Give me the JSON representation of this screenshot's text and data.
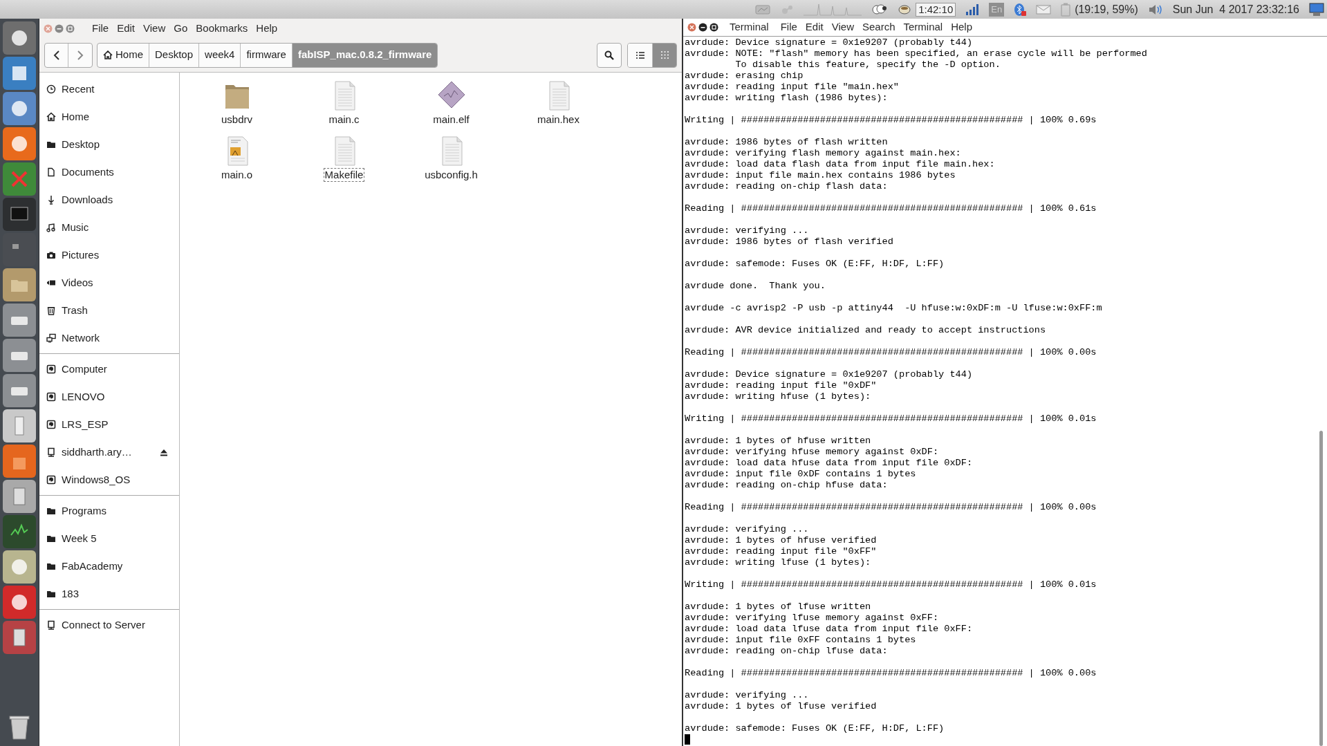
{
  "top_panel": {
    "timer": "1:42:10",
    "keyboard": "En",
    "battery": "(19:19, 59%)",
    "datetime": "Sun Jun  4 2017 23:32:16"
  },
  "file_manager": {
    "menu": [
      "File",
      "Edit",
      "View",
      "Go",
      "Bookmarks",
      "Help"
    ],
    "breadcrumb": [
      {
        "label": "Home",
        "kind": "home",
        "selected": false
      },
      {
        "label": "Desktop",
        "kind": "plain",
        "selected": false
      },
      {
        "label": "week4",
        "kind": "plain",
        "selected": false
      },
      {
        "label": "firmware",
        "kind": "plain",
        "selected": false
      },
      {
        "label": "fabISP_mac.0.8.2_firmware",
        "kind": "plain",
        "selected": true
      }
    ],
    "views": [
      {
        "kind": "list",
        "selected": false
      },
      {
        "kind": "grid",
        "selected": true
      }
    ],
    "sidebar": [
      [
        {
          "label": "Recent",
          "kind": "clock",
          "ejectable": false
        },
        {
          "label": "Home",
          "kind": "home",
          "ejectable": false
        },
        {
          "label": "Desktop",
          "kind": "folder",
          "ejectable": false
        },
        {
          "label": "Documents",
          "kind": "document",
          "ejectable": false
        },
        {
          "label": "Downloads",
          "kind": "download",
          "ejectable": false
        },
        {
          "label": "Music",
          "kind": "music",
          "ejectable": false
        },
        {
          "label": "Pictures",
          "kind": "camera",
          "ejectable": false
        },
        {
          "label": "Videos",
          "kind": "video",
          "ejectable": false
        },
        {
          "label": "Trash",
          "kind": "trash",
          "ejectable": false
        },
        {
          "label": "Network",
          "kind": "network",
          "ejectable": false
        }
      ],
      [
        {
          "label": "Computer",
          "kind": "drive",
          "ejectable": false
        },
        {
          "label": "LENOVO",
          "kind": "drive",
          "ejectable": false
        },
        {
          "label": "LRS_ESP",
          "kind": "drive",
          "ejectable": false
        },
        {
          "label": "siddharth.ary…",
          "kind": "server",
          "ejectable": true
        },
        {
          "label": "Windows8_OS",
          "kind": "drive",
          "ejectable": false
        }
      ],
      [
        {
          "label": "Programs",
          "kind": "folder",
          "ejectable": false
        },
        {
          "label": "Week 5",
          "kind": "folder",
          "ejectable": false
        },
        {
          "label": "FabAcademy",
          "kind": "folder",
          "ejectable": false
        },
        {
          "label": "183",
          "kind": "folder",
          "ejectable": false
        }
      ],
      [
        {
          "label": "Connect to Server",
          "kind": "server",
          "ejectable": false
        }
      ]
    ],
    "files": [
      {
        "name": "usbdrv",
        "kind": "folder",
        "focused": false
      },
      {
        "name": "main.c",
        "kind": "text",
        "focused": false
      },
      {
        "name": "main.elf",
        "kind": "binary",
        "focused": false
      },
      {
        "name": "main.hex",
        "kind": "text",
        "focused": false
      },
      {
        "name": "main.o",
        "kind": "image-document",
        "focused": false
      },
      {
        "name": "Makefile",
        "kind": "text",
        "focused": true
      },
      {
        "name": "usbconfig.h",
        "kind": "text",
        "focused": false
      }
    ]
  },
  "terminal": {
    "title": "Terminal",
    "menu": [
      "File",
      "Edit",
      "View",
      "Search",
      "Terminal",
      "Help"
    ],
    "blocks": [
      [
        "avrdude: Device signature = 0x1e9207 (probably t44)",
        "avrdude: NOTE: \"flash\" memory has been specified, an erase cycle will be performed",
        "         To disable this feature, specify the -D option.",
        "avrdude: erasing chip",
        "avrdude: reading input file \"main.hex\"",
        "avrdude: writing flash (1986 bytes):"
      ],
      [
        "Writing | ################################################## | 100% 0.69s"
      ],
      [
        "avrdude: 1986 bytes of flash written",
        "avrdude: verifying flash memory against main.hex:",
        "avrdude: load data flash data from input file main.hex:",
        "avrdude: input file main.hex contains 1986 bytes",
        "avrdude: reading on-chip flash data:"
      ],
      [
        "Reading | ################################################## | 100% 0.61s"
      ],
      [
        "avrdude: verifying ...",
        "avrdude: 1986 bytes of flash verified"
      ],
      [
        "avrdude: safemode: Fuses OK (E:FF, H:DF, L:FF)"
      ],
      [
        "avrdude done.  Thank you."
      ],
      [
        "avrdude -c avrisp2 -P usb -p attiny44  -U hfuse:w:0xDF:m -U lfuse:w:0xFF:m"
      ],
      [
        "avrdude: AVR device initialized and ready to accept instructions"
      ],
      [
        "Reading | ################################################## | 100% 0.00s"
      ],
      [
        "avrdude: Device signature = 0x1e9207 (probably t44)",
        "avrdude: reading input file \"0xDF\"",
        "avrdude: writing hfuse (1 bytes):"
      ],
      [
        "Writing | ################################################## | 100% 0.01s"
      ],
      [
        "avrdude: 1 bytes of hfuse written",
        "avrdude: verifying hfuse memory against 0xDF:",
        "avrdude: load data hfuse data from input file 0xDF:",
        "avrdude: input file 0xDF contains 1 bytes",
        "avrdude: reading on-chip hfuse data:"
      ],
      [
        "Reading | ################################################## | 100% 0.00s"
      ],
      [
        "avrdude: verifying ...",
        "avrdude: 1 bytes of hfuse verified",
        "avrdude: reading input file \"0xFF\"",
        "avrdude: writing lfuse (1 bytes):"
      ],
      [
        "Writing | ################################################## | 100% 0.01s"
      ],
      [
        "avrdude: 1 bytes of lfuse written",
        "avrdude: verifying lfuse memory against 0xFF:",
        "avrdude: load data lfuse data from input file 0xFF:",
        "avrdude: input file 0xFF contains 1 bytes",
        "avrdude: reading on-chip lfuse data:"
      ],
      [
        "Reading | ################################################## | 100% 0.00s"
      ],
      [
        "avrdude: verifying ...",
        "avrdude: 1 bytes of lfuse verified"
      ],
      [
        "avrdude: safemode: Fuses OK (E:FF, H:DF, L:FF)"
      ]
    ]
  }
}
